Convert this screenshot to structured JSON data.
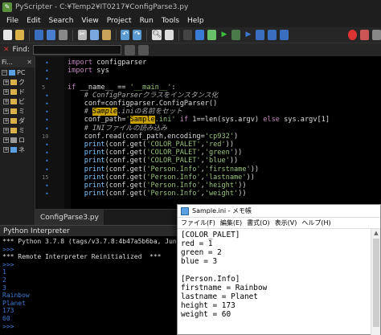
{
  "window": {
    "title": "PyScripter - C:¥Temp2¥IT0217¥ConfigParse3.py"
  },
  "menu": [
    "File",
    "Edit",
    "Search",
    "View",
    "Project",
    "Run",
    "Tools",
    "Help"
  ],
  "find": {
    "label": "Find:"
  },
  "sidebar": {
    "header": "Fi...",
    "items": [
      "PC",
      "ク",
      "ド",
      "ビ",
      "ミ",
      "ダ",
      "ミ",
      "ロ",
      "ネ"
    ]
  },
  "editor": {
    "lines": [
      {
        "ln": "",
        "html": "<span class=\"kw\">import</span> configparser"
      },
      {
        "ln": "",
        "html": "<span class=\"kw\">import</span> sys"
      },
      {
        "ln": "",
        "html": ""
      },
      {
        "ln": "5",
        "html": "<span class=\"kw\">if</span> __name__ == <span class=\"str\">'__main__'</span>:"
      },
      {
        "ln": "",
        "html": "    <span class=\"cm\"># ConfigParserクラスをインスタンス化</span>"
      },
      {
        "ln": "",
        "html": "    conf=configparser.ConfigParser()"
      },
      {
        "ln": "",
        "html": "    <span class=\"cm\"># <span class=\"hl\">Sample</span>.iniの名前をセット</span>"
      },
      {
        "ln": "",
        "html": "    conf_path=<span class=\"str\">'<span class=\"hl\">Sample</span>.ini'</span> <span class=\"kw\">if</span> 1==len(sys.argv) <span class=\"kw\">else</span> sys.argv[1]"
      },
      {
        "ln": "",
        "html": "    <span class=\"cm\"># INIファイルの読み込み</span>"
      },
      {
        "ln": "10",
        "html": "    conf.read(conf_path,encoding=<span class=\"str\">'cp932'</span>)"
      },
      {
        "ln": "",
        "html": "    <span class=\"fn\">print</span>(conf.get(<span class=\"str\">'COLOR_PALET'</span>,<span class=\"str\">'red'</span>))"
      },
      {
        "ln": "",
        "html": "    <span class=\"fn\">print</span>(conf.get(<span class=\"str\">'COLOR_PALET'</span>,<span class=\"str\">'green'</span>))"
      },
      {
        "ln": "",
        "html": "    <span class=\"fn\">print</span>(conf.get(<span class=\"str\">'COLOR_PALET'</span>,<span class=\"str\">'blue'</span>))"
      },
      {
        "ln": "",
        "html": "    <span class=\"fn\">print</span>(conf.get(<span class=\"str\">'Person.Info'</span>,<span class=\"str\">'firstname'</span>))"
      },
      {
        "ln": "15",
        "html": "    <span class=\"fn\">print</span>(conf.get(<span class=\"str\">'Person.Info'</span>,<span class=\"str\">'lastname'</span>))"
      },
      {
        "ln": "",
        "html": "    <span class=\"fn\">print</span>(conf.get(<span class=\"str\">'Person.Info'</span>,<span class=\"str\">'height'</span>))"
      },
      {
        "ln": "",
        "html": "    <span class=\"fn\">print</span>(conf.get(<span class=\"str\">'Person.Info'</span>,<span class=\"str\">'weight'</span>))"
      }
    ]
  },
  "tab": {
    "label": "ConfigParse3.py"
  },
  "interpreter": {
    "title": "Python Interpreter",
    "lines": [
      {
        "text": "*** Python 3.7.8 (tags/v3.7.8:4b47a5b6ba, Jun",
        "color": "#ddd"
      },
      {
        "text": ">>>",
        "color": "#3a7bd5"
      },
      {
        "text": "*** Remote Interpreter Reinitialized  ***",
        "color": "#ddd"
      },
      {
        "text": ">>>",
        "color": "#3a7bd5"
      },
      {
        "text": "1",
        "color": "#3a7bd5"
      },
      {
        "text": "2",
        "color": "#3a7bd5"
      },
      {
        "text": "3",
        "color": "#3a7bd5"
      },
      {
        "text": "Rainbow",
        "color": "#3a7bd5"
      },
      {
        "text": "Planet",
        "color": "#3a7bd5"
      },
      {
        "text": "173",
        "color": "#3a7bd5"
      },
      {
        "text": "60",
        "color": "#3a7bd5"
      },
      {
        "text": ">>>",
        "color": "#3a7bd5"
      }
    ]
  },
  "notepad": {
    "title": "Sample.ini - メモ帳",
    "menu": [
      "ファイル(F)",
      "編集(E)",
      "書式(O)",
      "表示(V)",
      "ヘルプ(H)"
    ],
    "lines": [
      "[COLOR_PALET]",
      "red = 1",
      "green = 2",
      "blue = 3",
      "",
      "[Person.Info]",
      "firstname = Rainbow",
      "lastname = Planet",
      "height = 173",
      "weight = 60"
    ]
  }
}
